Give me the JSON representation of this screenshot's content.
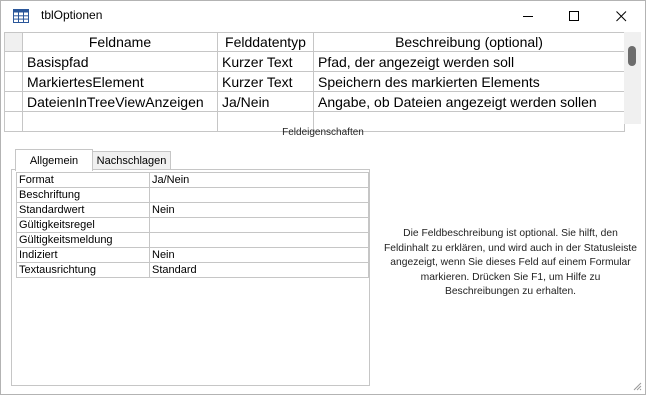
{
  "window": {
    "title": "tblOptionen"
  },
  "grid": {
    "columns": [
      "Feldname",
      "Felddatentyp",
      "Beschreibung (optional)"
    ],
    "rows": [
      {
        "name": "Basispfad",
        "type": "Kurzer Text",
        "desc": "Pfad, der angezeigt werden soll"
      },
      {
        "name": "MarkiertesElement",
        "type": "Kurzer Text",
        "desc": "Speichern des markierten Elements"
      },
      {
        "name": "DateienInTreeViewAnzeigen",
        "type": "Ja/Nein",
        "desc": "Angabe, ob Dateien angezeigt werden sollen"
      },
      {
        "name": "",
        "type": "",
        "desc": ""
      }
    ]
  },
  "properties": {
    "heading": "Feldeigenschaften",
    "tabs": [
      "Allgemein",
      "Nachschlagen"
    ],
    "rows": [
      {
        "label": "Format",
        "value": "Ja/Nein"
      },
      {
        "label": "Beschriftung",
        "value": ""
      },
      {
        "label": "Standardwert",
        "value": "Nein"
      },
      {
        "label": "Gültigkeitsregel",
        "value": ""
      },
      {
        "label": "Gültigkeitsmeldung",
        "value": ""
      },
      {
        "label": "Indiziert",
        "value": "Nein"
      },
      {
        "label": "Textausrichtung",
        "value": "Standard"
      }
    ],
    "help_text": "Die Feldbeschreibung ist optional. Sie hilft, den Feldinhalt zu erklären, und wird auch in der Statusleiste angezeigt, wenn Sie dieses Feld auf einem Formular markieren. Drücken Sie F1, um Hilfe zu Beschreibungen zu erhalten."
  },
  "icons": {
    "app": "table-icon",
    "minimize": "minimize-icon",
    "maximize": "maximize-icon",
    "close": "close-icon"
  },
  "colors": {
    "grid_border": "#c6c6c6",
    "app_icon": "#2b579a"
  }
}
